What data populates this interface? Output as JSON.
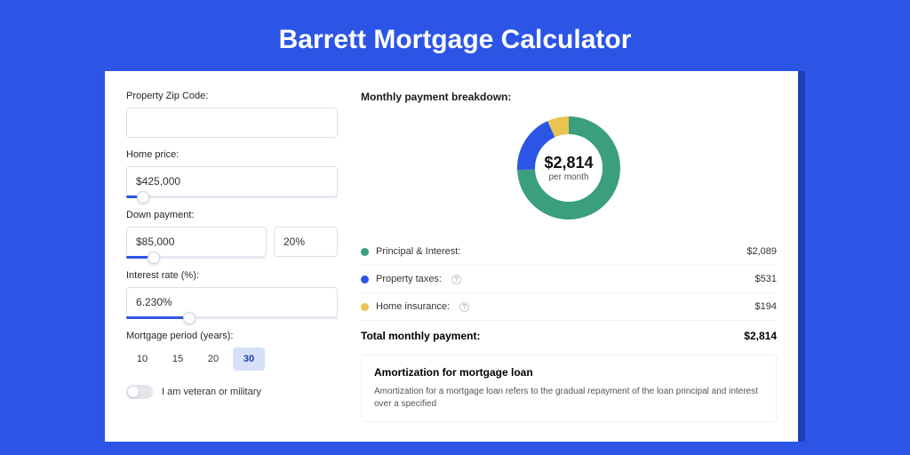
{
  "title": "Barrett Mortgage Calculator",
  "form": {
    "zip": {
      "label": "Property Zip Code:",
      "value": ""
    },
    "home_price": {
      "label": "Home price:",
      "value": "$425,000",
      "slider_pct": 8
    },
    "down_payment": {
      "label": "Down payment:",
      "amount": "$85,000",
      "percent": "20%",
      "slider_pct": 20
    },
    "interest": {
      "label": "Interest rate (%):",
      "value": "6.230%",
      "slider_pct": 30
    },
    "period": {
      "label": "Mortgage period (years):",
      "options": [
        "10",
        "15",
        "20",
        "30"
      ],
      "active": "30"
    },
    "veteran": {
      "label": "I am veteran or military",
      "on": false
    }
  },
  "breakdown": {
    "title": "Monthly payment breakdown:",
    "center_amount": "$2,814",
    "center_sub": "per month",
    "items": [
      {
        "label": "Principal & Interest:",
        "value": "$2,089",
        "color": "#3b9e7e",
        "info": false
      },
      {
        "label": "Property taxes:",
        "value": "$531",
        "color": "#2c55e6",
        "info": true
      },
      {
        "label": "Home insurance:",
        "value": "$194",
        "color": "#e9c452",
        "info": true
      }
    ],
    "total_label": "Total monthly payment:",
    "total_value": "$2,814"
  },
  "chart_data": {
    "type": "pie",
    "title": "Monthly payment breakdown",
    "series": [
      {
        "name": "Principal & Interest",
        "value": 2089,
        "color": "#3b9e7e"
      },
      {
        "name": "Property taxes",
        "value": 531,
        "color": "#2c55e6"
      },
      {
        "name": "Home insurance",
        "value": 194,
        "color": "#e9c452"
      }
    ],
    "total": 2814,
    "center_label": "$2,814 per month"
  },
  "amortization": {
    "title": "Amortization for mortgage loan",
    "body": "Amortization for a mortgage loan refers to the gradual repayment of the loan principal and interest over a specified"
  }
}
